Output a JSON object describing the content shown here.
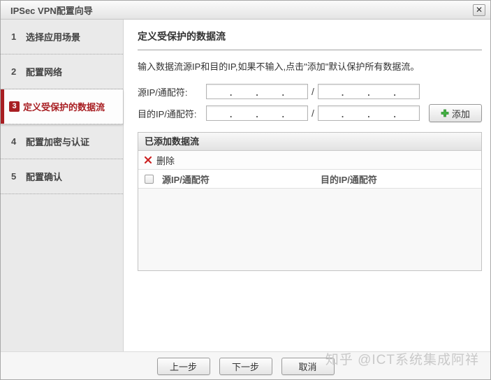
{
  "window": {
    "title": "IPSec VPN配置向导",
    "close_glyph": "✕"
  },
  "sidebar": {
    "steps": [
      {
        "num": "1",
        "label": "选择应用场景",
        "active": false
      },
      {
        "num": "2",
        "label": "配置网络",
        "active": false
      },
      {
        "num": "3",
        "label": "定义受保护的数据流",
        "active": true
      },
      {
        "num": "4",
        "label": "配置加密与认证",
        "active": false
      },
      {
        "num": "5",
        "label": "配置确认",
        "active": false
      }
    ]
  },
  "main": {
    "title": "定义受保护的数据流",
    "description": "输入数据流源IP和目的IP,如果不输入,点击\"添加\"默认保护所有数据流。",
    "form": {
      "source_label": "源IP/通配符:",
      "dest_label": "目的IP/通配符:",
      "separator": "/",
      "octet_separator": ".",
      "source_ip_value": "",
      "source_wildcard_value": "",
      "dest_ip_value": "",
      "dest_wildcard_value": "",
      "add_button": "添加"
    },
    "table": {
      "title": "已添加数据流",
      "delete_label": "删除",
      "columns": [
        "源IP/通配符",
        "目的IP/通配符"
      ],
      "rows": []
    }
  },
  "footer": {
    "buttons": [
      "上一步",
      "下一步",
      "取消"
    ]
  },
  "watermark": "知乎 @ICT系统集成阿祥",
  "colors": {
    "accent_red": "#a81e22",
    "add_green": "#44b244",
    "delete_red": "#cc2222",
    "watermark_gray": "#c9c9c9"
  }
}
